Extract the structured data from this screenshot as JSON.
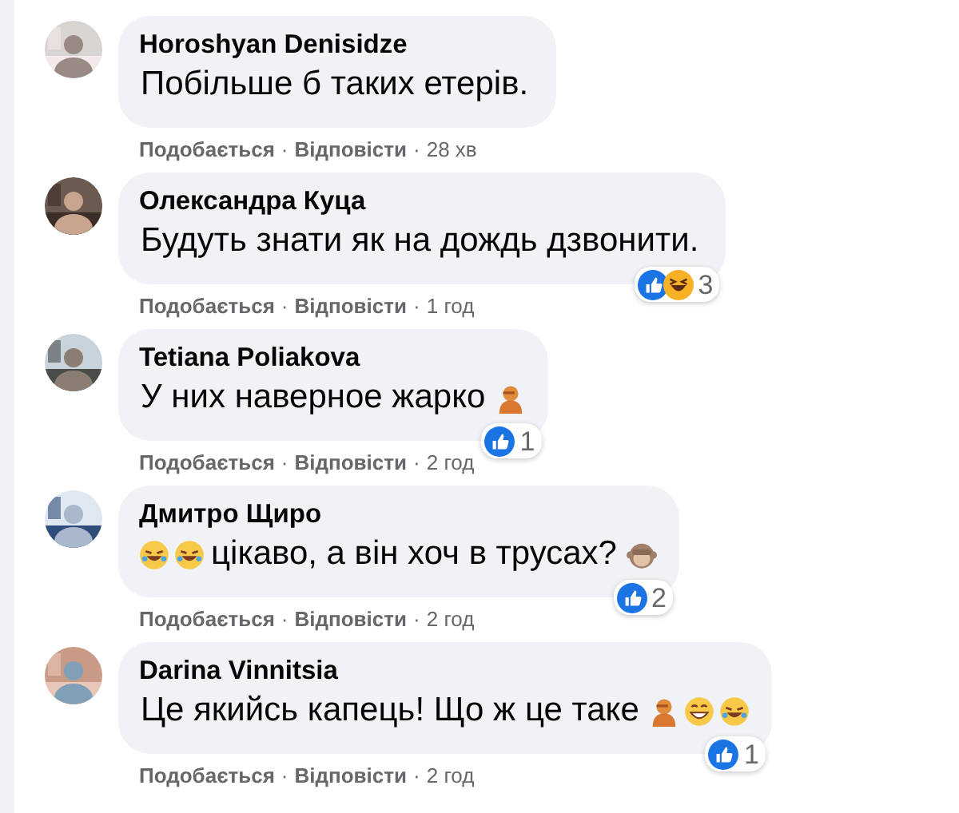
{
  "comments": [
    {
      "author": "Horoshyan Denisidze",
      "text": "Побільше б таких етерів.",
      "like": "Подобається",
      "sep1": "·",
      "reply": "Відповісти",
      "sep2": "·",
      "time": "28 хв"
    },
    {
      "author": "Олександра Куца",
      "text": "Будуть знати як на дождь дзвонити.",
      "reactions": {
        "icons": [
          {
            "kind": "like"
          },
          {
            "kind": "haha"
          }
        ],
        "count": "3"
      },
      "like": "Подобається",
      "sep1": "·",
      "reply": "Відповісти",
      "sep2": "·",
      "time": "1 год"
    },
    {
      "author": "Tetiana Poliakova",
      "text": "У них наверное жарко",
      "emoji_after": [
        {
          "kind": "facepalm"
        }
      ],
      "reactions": {
        "icons": [
          {
            "kind": "like"
          }
        ],
        "count": "1"
      },
      "like": "Подобається",
      "sep1": "·",
      "reply": "Відповісти",
      "sep2": "·",
      "time": "2 год"
    },
    {
      "author": "Дмитро Щиро",
      "text": "цікаво, а він хоч в трусах?",
      "emoji_before": [
        {
          "kind": "rofl"
        },
        {
          "kind": "rofl"
        }
      ],
      "emoji_after": [
        {
          "kind": "monkey"
        }
      ],
      "reactions": {
        "icons": [
          {
            "kind": "like"
          }
        ],
        "count": "2"
      },
      "like": "Подобається",
      "sep1": "·",
      "reply": "Відповісти",
      "sep2": "·",
      "time": "2 год"
    },
    {
      "author": "Darina Vinnitsia",
      "text": "Це якийсь капець! Що ж це таке",
      "emoji_after": [
        {
          "kind": "facepalm"
        },
        {
          "kind": "grin"
        },
        {
          "kind": "rofl"
        }
      ],
      "reactions": {
        "icons": [
          {
            "kind": "like"
          }
        ],
        "count": "1"
      },
      "like": "Подобається",
      "sep1": "·",
      "reply": "Відповісти",
      "sep2": "·",
      "time": "2 год"
    }
  ]
}
